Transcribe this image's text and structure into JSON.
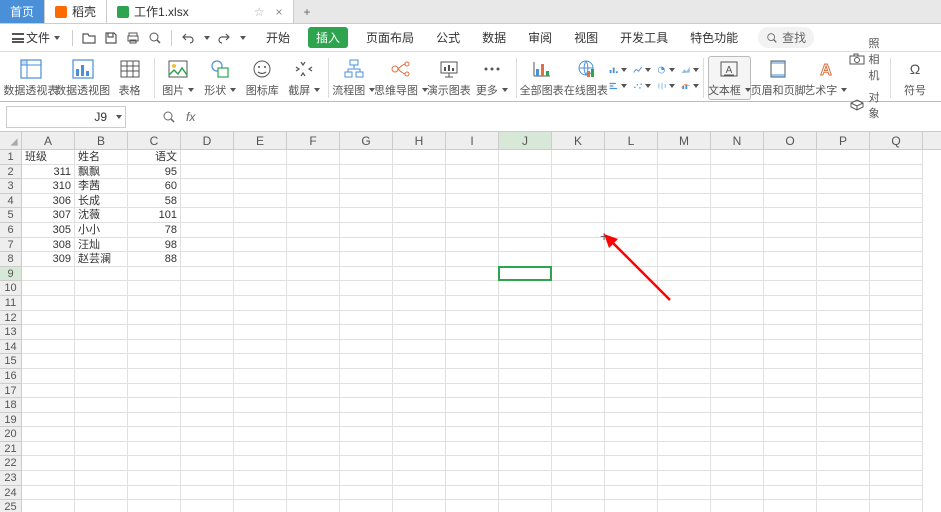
{
  "tabs": {
    "home": "首页",
    "docker": "稻壳",
    "file": "工作1.xlsx",
    "pin": "☆",
    "close": "×",
    "add": "+"
  },
  "menu": {
    "file_btn": "文件",
    "tabs": [
      "开始",
      "插入",
      "页面布局",
      "公式",
      "数据",
      "审阅",
      "视图",
      "开发工具",
      "特色功能"
    ],
    "active_idx": 1,
    "search": "查找"
  },
  "ribbon": {
    "g1": "数据透视表",
    "g2": "数据透视图",
    "g3": "表格",
    "g4": "图片",
    "g5": "形状",
    "g6": "图标库",
    "g7": "截屏",
    "g8": "流程图",
    "g9": "思维导图",
    "g10": "演示图表",
    "g11": "更多",
    "g12": "全部图表",
    "g13": "在线图表",
    "g14": "文本框",
    "g15": "页眉和页脚",
    "g16": "艺术字",
    "g17": "照相机",
    "g18": "对象",
    "g19": "符号"
  },
  "fbar": {
    "name": "J9",
    "fx": "fx"
  },
  "cols": [
    "A",
    "B",
    "C",
    "D",
    "E",
    "F",
    "G",
    "H",
    "I",
    "J",
    "K",
    "L",
    "M",
    "N",
    "O",
    "P",
    "Q"
  ],
  "sel_col_idx": 9,
  "rows_count": 25,
  "sel_row_idx": 9,
  "table": {
    "headers": {
      "a": "班级",
      "b": "姓名",
      "c": "语文"
    },
    "rows": [
      {
        "a": "311",
        "b": "飘飘",
        "c": "95"
      },
      {
        "a": "310",
        "b": "李茜",
        "c": "60"
      },
      {
        "a": "306",
        "b": "长成",
        "c": "58"
      },
      {
        "a": "307",
        "b": "沈薇",
        "c": "101"
      },
      {
        "a": "305",
        "b": "小小",
        "c": "78"
      },
      {
        "a": "308",
        "b": "汪灿",
        "c": "98"
      },
      {
        "a": "309",
        "b": "赵芸澜",
        "c": "88"
      }
    ]
  }
}
